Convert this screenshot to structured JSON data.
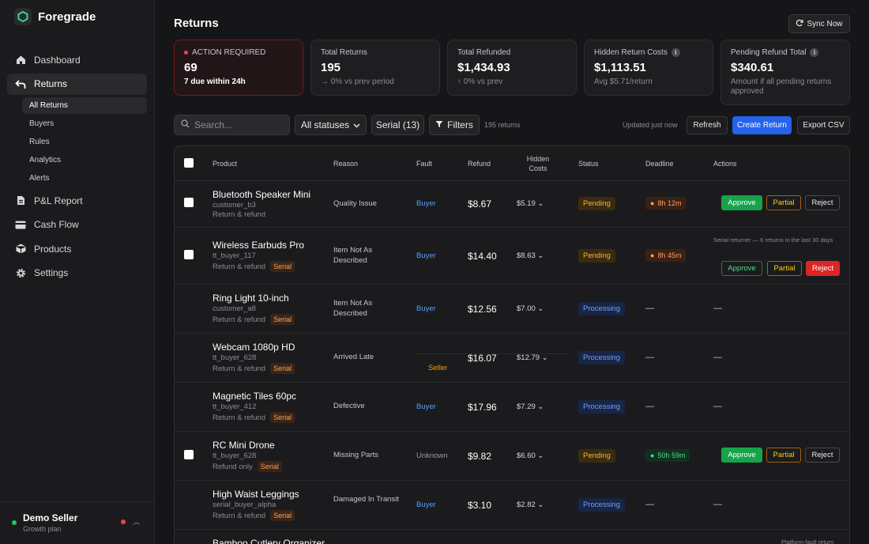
{
  "app": {
    "name": "Foregrade",
    "accent": "#2563eb"
  },
  "sidebar": {
    "items": [
      {
        "label": "Dashboard",
        "icon": "home-icon"
      },
      {
        "label": "Returns",
        "icon": "return-arrow-icon"
      },
      {
        "label": "P&L Report",
        "icon": "document-icon"
      },
      {
        "label": "Cash Flow",
        "icon": "credit-card-icon"
      },
      {
        "label": "Products",
        "icon": "box-icon"
      },
      {
        "label": "Settings",
        "icon": "gear-icon"
      }
    ],
    "subitems": [
      "All Returns",
      "Buyers",
      "Rules",
      "Analytics",
      "Alerts"
    ],
    "seller": {
      "name": "Demo Seller",
      "plan": "Growth plan"
    }
  },
  "header": {
    "title": "Returns",
    "sync_label": "Sync Now"
  },
  "cards": [
    {
      "label": "ACTION REQUIRED",
      "value": "69",
      "sub": "7 due within 24h"
    },
    {
      "label": "Total Returns",
      "value": "195",
      "sub": "→ 0% vs prev period"
    },
    {
      "label": "Total Refunded",
      "value": "$1,434.93",
      "sub": "↑ 0% vs prev"
    },
    {
      "label": "Hidden Return Costs",
      "value": "$1,113.51",
      "sub": "Avg $5.71/return"
    },
    {
      "label": "Pending Refund Total",
      "value": "$340.61",
      "sub": "Amount if all pending returns approved"
    }
  ],
  "toolbar": {
    "search_placeholder": "Search...",
    "status_filter": "All statuses",
    "serial_filter": "Serial (13)",
    "filters_label": "Filters",
    "count": "195 returns",
    "updated": "Updated just now",
    "refresh": "Refresh",
    "create": "Create Return",
    "export": "Export CSV"
  },
  "table": {
    "headers": [
      "Product",
      "Reason",
      "Fault",
      "Refund",
      "Hidden Costs",
      "Status",
      "Deadline",
      "Actions"
    ],
    "rows": [
      {
        "name": "Bluetooth Speaker Mini",
        "customer": "customer_b3",
        "type": "Return & refund",
        "serial": "",
        "reason": "Quality Issue",
        "fault": "Buyer",
        "refund": "$8.67",
        "hidden": "$5.19",
        "status": "Pending",
        "deadline": "8h 12m",
        "note": ""
      },
      {
        "name": "Wireless Earbuds Pro",
        "customer": "tt_buyer_117",
        "type": "Return & refund",
        "serial": "Serial",
        "reason": "Item Not As Described",
        "fault": "Buyer",
        "refund": "$14.40",
        "hidden": "$8.63",
        "status": "Pending",
        "deadline": "8h 45m",
        "note": "Serial returner — 6 returns in the last 30 days"
      },
      {
        "name": "Ring Light 10-inch",
        "customer": "customer_a8",
        "type": "Return & refund",
        "serial": "Serial",
        "reason": "Item Not As Described",
        "fault": "Buyer",
        "refund": "$12.56",
        "hidden": "$7.00",
        "status": "Processing",
        "deadline": "—",
        "note": ""
      },
      {
        "name": "Webcam 1080p HD",
        "customer": "tt_buyer_628",
        "type": "Return & refund",
        "serial": "Serial",
        "reason": "Arrived Late",
        "fault": "Seller",
        "refund": "$16.07",
        "hidden": "$12.79",
        "status": "Processing",
        "deadline": "—",
        "note": ""
      },
      {
        "name": "Magnetic Tiles 60pc",
        "customer": "tt_buyer_412",
        "type": "Return & refund",
        "serial": "Serial",
        "reason": "Defective",
        "fault": "Buyer",
        "refund": "$17.96",
        "hidden": "$7.29",
        "status": "Processing",
        "deadline": "—",
        "note": ""
      },
      {
        "name": "RC Mini Drone",
        "customer": "tt_buyer_628",
        "type": "Refund only",
        "serial": "Serial",
        "reason": "Missing Parts",
        "fault": "Unknown",
        "refund": "$9.82",
        "hidden": "$6.60",
        "status": "Pending",
        "deadline": "50h 59m",
        "note": ""
      },
      {
        "name": "High Waist Leggings",
        "customer": "serial_buyer_alpha",
        "type": "Return & refund",
        "serial": "Serial",
        "reason": "Damaged In Transit",
        "fault": "Buyer",
        "refund": "$3.10",
        "hidden": "$2.82",
        "status": "Processing",
        "deadline": "—",
        "note": ""
      },
      {
        "name": "Bamboo Cutlery Organizer",
        "note": "Platform-fault return"
      }
    ],
    "actions": {
      "approve": "Approve",
      "partial": "Partial",
      "reject": "Reject",
      "dash": "—"
    }
  }
}
